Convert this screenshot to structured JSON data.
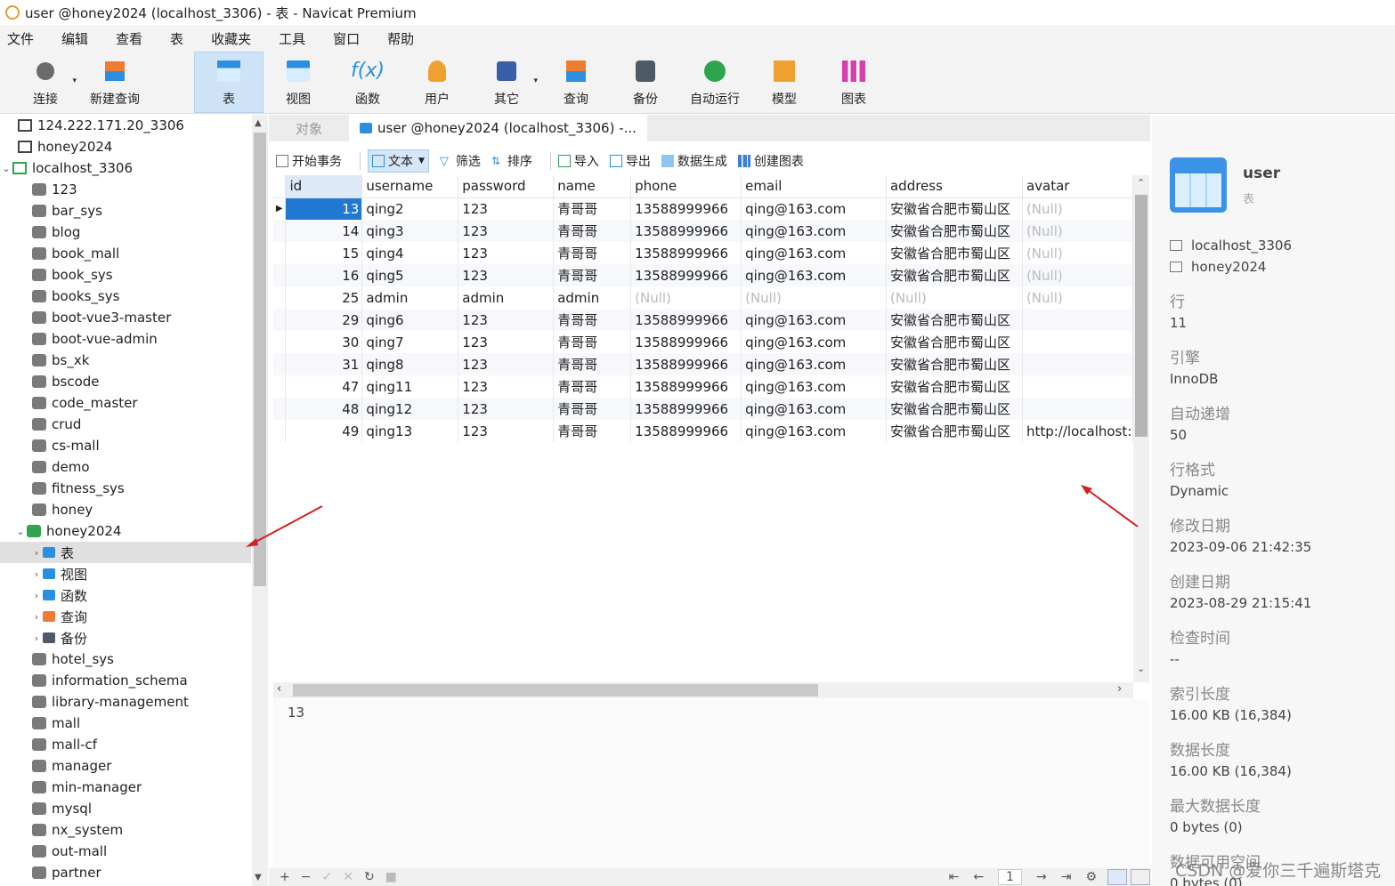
{
  "window": {
    "title": "user @honey2024 (localhost_3306) - 表 - Navicat Premium"
  },
  "menu": [
    "文件",
    "编辑",
    "查看",
    "表",
    "收藏夹",
    "工具",
    "窗口",
    "帮助"
  ],
  "toolbar": {
    "items": [
      {
        "label": "连接",
        "icon": "plug-icon"
      },
      {
        "label": "新建查询",
        "icon": "new-query-icon"
      },
      {
        "label": "表",
        "icon": "table-icon"
      },
      {
        "label": "视图",
        "icon": "view-icon"
      },
      {
        "label": "函数",
        "icon": "function-icon"
      },
      {
        "label": "用户",
        "icon": "user-icon"
      },
      {
        "label": "其它",
        "icon": "tools-icon"
      },
      {
        "label": "查询",
        "icon": "query-icon"
      },
      {
        "label": "备份",
        "icon": "backup-icon"
      },
      {
        "label": "自动运行",
        "icon": "robot-icon"
      },
      {
        "label": "模型",
        "icon": "model-icon"
      },
      {
        "label": "图表",
        "icon": "chart-icon"
      }
    ]
  },
  "navigator": {
    "connections": [
      "124.222.171.20_3306",
      "honey2024",
      "localhost_3306"
    ],
    "databases": [
      "123",
      "bar_sys",
      "blog",
      "book_mall",
      "book_sys",
      "books_sys",
      "boot-vue3-master",
      "boot-vue-admin",
      "bs_xk",
      "bscode",
      "code_master",
      "crud",
      "cs-mall",
      "demo",
      "fitness_sys",
      "honey"
    ],
    "open_database": "honey2024",
    "open_children": [
      "表",
      "视图",
      "函数",
      "查询",
      "备份"
    ],
    "more_databases": [
      "hotel_sys",
      "information_schema",
      "library-management",
      "mall",
      "mall-cf",
      "manager",
      "min-manager",
      "mysql",
      "nx_system",
      "out-mall",
      "partner"
    ]
  },
  "tabs": {
    "objects": "对象",
    "active": "user @honey2024 (localhost_3306) -..."
  },
  "datatoolbar": {
    "begin_transaction": "开始事务",
    "text": "文本",
    "filter": "筛选",
    "sort": "排序",
    "import": "导入",
    "export": "导出",
    "generate_data": "数据生成",
    "create_chart": "创建图表"
  },
  "grid": {
    "columns": [
      "id",
      "username",
      "password",
      "name",
      "phone",
      "email",
      "address",
      "avatar"
    ],
    "rows": [
      [
        "13",
        "qing2",
        "123",
        "青哥哥",
        "13588999966",
        "qing@163.com",
        "安徽省合肥市蜀山区",
        "(Null)"
      ],
      [
        "14",
        "qing3",
        "123",
        "青哥哥",
        "13588999966",
        "qing@163.com",
        "安徽省合肥市蜀山区",
        "(Null)"
      ],
      [
        "15",
        "qing4",
        "123",
        "青哥哥",
        "13588999966",
        "qing@163.com",
        "安徽省合肥市蜀山区",
        "(Null)"
      ],
      [
        "16",
        "qing5",
        "123",
        "青哥哥",
        "13588999966",
        "qing@163.com",
        "安徽省合肥市蜀山区",
        "(Null)"
      ],
      [
        "25",
        "admin",
        "admin",
        "admin",
        "(Null)",
        "(Null)",
        "(Null)",
        "(Null)"
      ],
      [
        "29",
        "qing6",
        "123",
        "青哥哥",
        "13588999966",
        "qing@163.com",
        "安徽省合肥市蜀山区",
        ""
      ],
      [
        "30",
        "qing7",
        "123",
        "青哥哥",
        "13588999966",
        "qing@163.com",
        "安徽省合肥市蜀山区",
        ""
      ],
      [
        "31",
        "qing8",
        "123",
        "青哥哥",
        "13588999966",
        "qing@163.com",
        "安徽省合肥市蜀山区",
        ""
      ],
      [
        "47",
        "qing11",
        "123",
        "青哥哥",
        "13588999966",
        "qing@163.com",
        "安徽省合肥市蜀山区",
        ""
      ],
      [
        "48",
        "qing12",
        "123",
        "青哥哥",
        "13588999966",
        "qing@163.com",
        "安徽省合肥市蜀山区",
        ""
      ],
      [
        "49",
        "qing13",
        "123",
        "青哥哥",
        "13588999966",
        "qing@163.com",
        "安徽省合肥市蜀山区",
        "http://localhost:"
      ]
    ]
  },
  "preview": {
    "value": "13"
  },
  "statusbar": {
    "page": "1"
  },
  "info": {
    "name": "user",
    "type": "表",
    "connection": "localhost_3306",
    "database": "honey2024",
    "props": [
      {
        "k": "行",
        "v": "11"
      },
      {
        "k": "引擎",
        "v": "InnoDB"
      },
      {
        "k": "自动递增",
        "v": "50"
      },
      {
        "k": "行格式",
        "v": "Dynamic"
      },
      {
        "k": "修改日期",
        "v": "2023-09-06 21:42:35"
      },
      {
        "k": "创建日期",
        "v": "2023-08-29 21:15:41"
      },
      {
        "k": "检查时间",
        "v": "--"
      },
      {
        "k": "索引长度",
        "v": "16.00 KB (16,384)"
      },
      {
        "k": "数据长度",
        "v": "16.00 KB (16,384)"
      },
      {
        "k": "最大数据长度",
        "v": "0 bytes (0)"
      },
      {
        "k": "数据可用空间",
        "v": "0 bytes (0)"
      }
    ]
  },
  "watermark": "CSDN @爱你三千遍斯塔克",
  "colors": {
    "selection": "#1f78d1",
    "accent": "#2a8fe0",
    "db_open": "#2fa44f"
  }
}
